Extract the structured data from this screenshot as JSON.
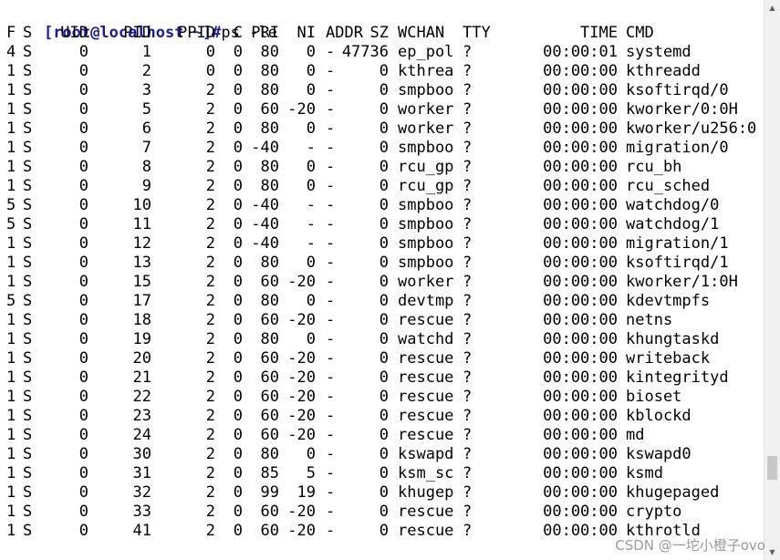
{
  "prompt": {
    "text": "[root@localhost ~]#",
    "command": "ps -le"
  },
  "headers": [
    "F",
    "S",
    "UID",
    "PID",
    "PPID",
    "C",
    "PRI",
    "NI",
    "ADDR",
    "SZ",
    "WCHAN",
    "TTY",
    "TIME",
    "CMD"
  ],
  "rows": [
    [
      "4",
      "S",
      "0",
      "1",
      "0",
      "0",
      "80",
      "0",
      "-",
      "47736",
      "ep_pol",
      "?",
      "00:00:01",
      "systemd"
    ],
    [
      "1",
      "S",
      "0",
      "2",
      "0",
      "0",
      "80",
      "0",
      "-",
      "0",
      "kthrea",
      "?",
      "00:00:00",
      "kthreadd"
    ],
    [
      "1",
      "S",
      "0",
      "3",
      "2",
      "0",
      "80",
      "0",
      "-",
      "0",
      "smpboo",
      "?",
      "00:00:00",
      "ksoftirqd/0"
    ],
    [
      "1",
      "S",
      "0",
      "5",
      "2",
      "0",
      "60",
      "-20",
      "-",
      "0",
      "worker",
      "?",
      "00:00:00",
      "kworker/0:0H"
    ],
    [
      "1",
      "S",
      "0",
      "6",
      "2",
      "0",
      "80",
      "0",
      "-",
      "0",
      "worker",
      "?",
      "00:00:00",
      "kworker/u256:0"
    ],
    [
      "1",
      "S",
      "0",
      "7",
      "2",
      "0",
      "-40",
      "-",
      "-",
      "0",
      "smpboo",
      "?",
      "00:00:00",
      "migration/0"
    ],
    [
      "1",
      "S",
      "0",
      "8",
      "2",
      "0",
      "80",
      "0",
      "-",
      "0",
      "rcu_gp",
      "?",
      "00:00:00",
      "rcu_bh"
    ],
    [
      "1",
      "S",
      "0",
      "9",
      "2",
      "0",
      "80",
      "0",
      "-",
      "0",
      "rcu_gp",
      "?",
      "00:00:00",
      "rcu_sched"
    ],
    [
      "5",
      "S",
      "0",
      "10",
      "2",
      "0",
      "-40",
      "-",
      "-",
      "0",
      "smpboo",
      "?",
      "00:00:00",
      "watchdog/0"
    ],
    [
      "5",
      "S",
      "0",
      "11",
      "2",
      "0",
      "-40",
      "-",
      "-",
      "0",
      "smpboo",
      "?",
      "00:00:00",
      "watchdog/1"
    ],
    [
      "1",
      "S",
      "0",
      "12",
      "2",
      "0",
      "-40",
      "-",
      "-",
      "0",
      "smpboo",
      "?",
      "00:00:00",
      "migration/1"
    ],
    [
      "1",
      "S",
      "0",
      "13",
      "2",
      "0",
      "80",
      "0",
      "-",
      "0",
      "smpboo",
      "?",
      "00:00:00",
      "ksoftirqd/1"
    ],
    [
      "1",
      "S",
      "0",
      "15",
      "2",
      "0",
      "60",
      "-20",
      "-",
      "0",
      "worker",
      "?",
      "00:00:00",
      "kworker/1:0H"
    ],
    [
      "5",
      "S",
      "0",
      "17",
      "2",
      "0",
      "80",
      "0",
      "-",
      "0",
      "devtmp",
      "?",
      "00:00:00",
      "kdevtmpfs"
    ],
    [
      "1",
      "S",
      "0",
      "18",
      "2",
      "0",
      "60",
      "-20",
      "-",
      "0",
      "rescue",
      "?",
      "00:00:00",
      "netns"
    ],
    [
      "1",
      "S",
      "0",
      "19",
      "2",
      "0",
      "80",
      "0",
      "-",
      "0",
      "watchd",
      "?",
      "00:00:00",
      "khungtaskd"
    ],
    [
      "1",
      "S",
      "0",
      "20",
      "2",
      "0",
      "60",
      "-20",
      "-",
      "0",
      "rescue",
      "?",
      "00:00:00",
      "writeback"
    ],
    [
      "1",
      "S",
      "0",
      "21",
      "2",
      "0",
      "60",
      "-20",
      "-",
      "0",
      "rescue",
      "?",
      "00:00:00",
      "kintegrityd"
    ],
    [
      "1",
      "S",
      "0",
      "22",
      "2",
      "0",
      "60",
      "-20",
      "-",
      "0",
      "rescue",
      "?",
      "00:00:00",
      "bioset"
    ],
    [
      "1",
      "S",
      "0",
      "23",
      "2",
      "0",
      "60",
      "-20",
      "-",
      "0",
      "rescue",
      "?",
      "00:00:00",
      "kblockd"
    ],
    [
      "1",
      "S",
      "0",
      "24",
      "2",
      "0",
      "60",
      "-20",
      "-",
      "0",
      "rescue",
      "?",
      "00:00:00",
      "md"
    ],
    [
      "1",
      "S",
      "0",
      "30",
      "2",
      "0",
      "80",
      "0",
      "-",
      "0",
      "kswapd",
      "?",
      "00:00:00",
      "kswapd0"
    ],
    [
      "1",
      "S",
      "0",
      "31",
      "2",
      "0",
      "85",
      "5",
      "-",
      "0",
      "ksm_sc",
      "?",
      "00:00:00",
      "ksmd"
    ],
    [
      "1",
      "S",
      "0",
      "32",
      "2",
      "0",
      "99",
      "19",
      "-",
      "0",
      "khugep",
      "?",
      "00:00:00",
      "khugepaged"
    ],
    [
      "1",
      "S",
      "0",
      "33",
      "2",
      "0",
      "60",
      "-20",
      "-",
      "0",
      "rescue",
      "?",
      "00:00:00",
      "crypto"
    ],
    [
      "1",
      "S",
      "0",
      "41",
      "2",
      "0",
      "60",
      "-20",
      "-",
      "0",
      "rescue",
      "?",
      "00:00:00",
      "kthrotld"
    ]
  ],
  "watermark": "CSDN @一坨小橙子ovo",
  "icons": {
    "scroll_up": "arrow-up-icon",
    "scroll_down": "arrow-down-icon"
  }
}
